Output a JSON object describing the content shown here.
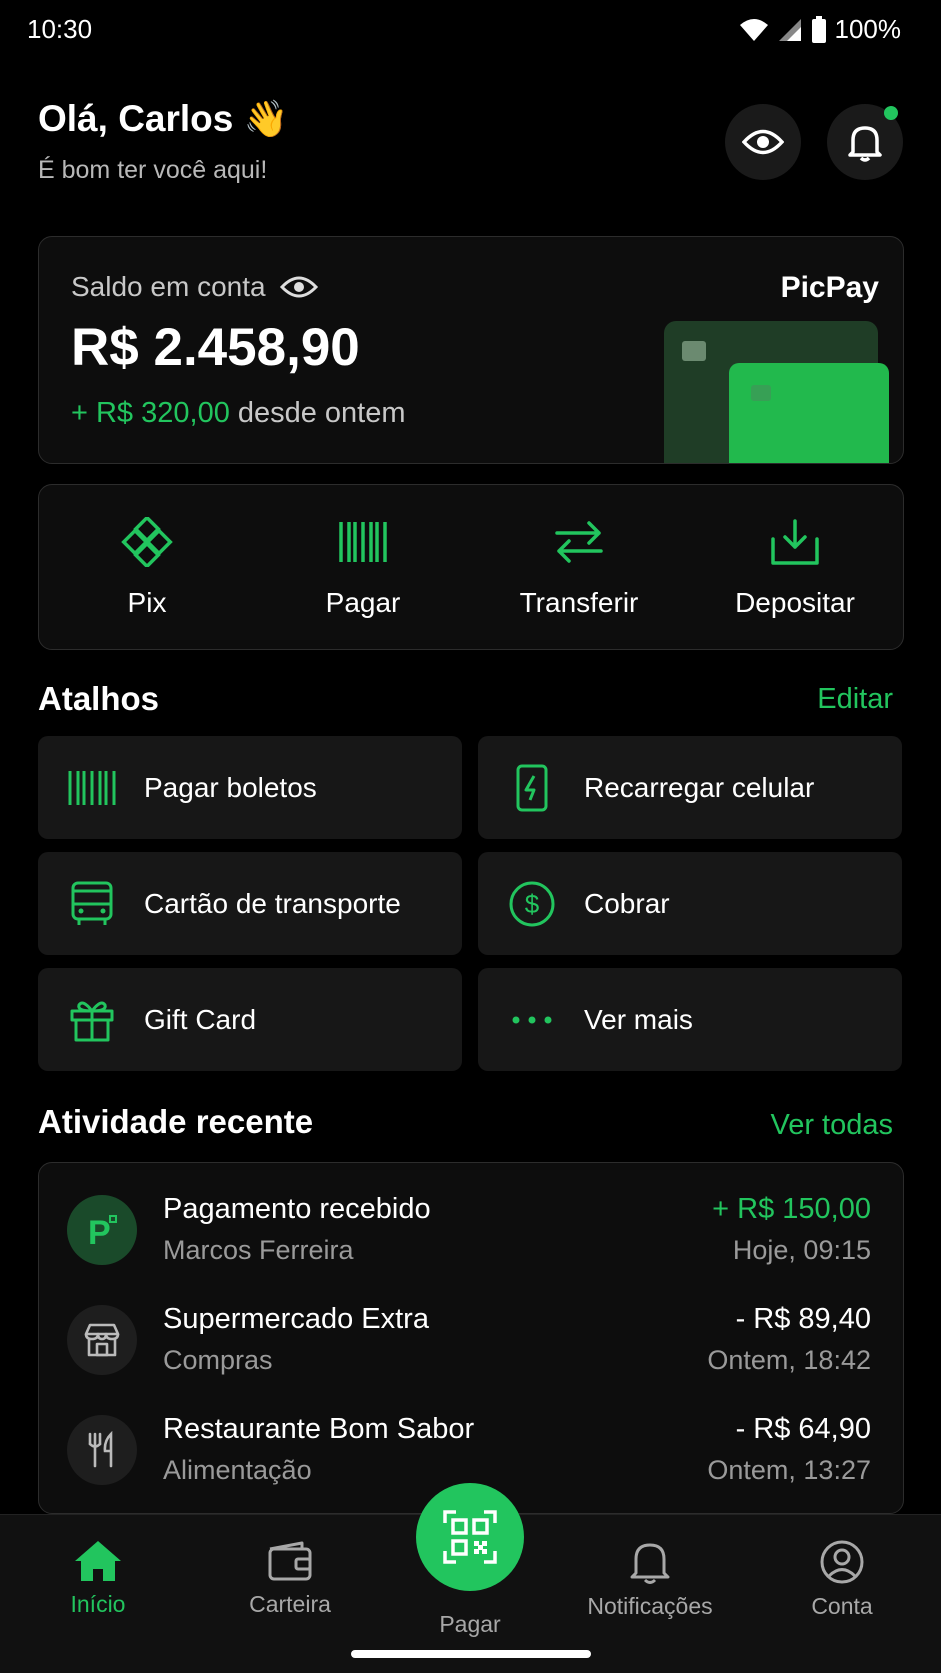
{
  "status_bar": {
    "time": "10:30",
    "battery": "100%"
  },
  "header": {
    "greeting": "Olá, Carlos",
    "emoji": "👋",
    "subtitle": "É bom ter você aqui!"
  },
  "balance": {
    "label": "Saldo em conta",
    "value": "R$ 2.458,90",
    "delta": "+ R$ 320,00",
    "delta_suffix": "desde ontem",
    "brand": "PicPay"
  },
  "quick_actions": [
    {
      "label": "Pix",
      "icon": "pix-icon"
    },
    {
      "label": "Pagar",
      "icon": "barcode-icon"
    },
    {
      "label": "Transferir",
      "icon": "transfer-icon"
    },
    {
      "label": "Depositar",
      "icon": "deposit-icon"
    }
  ],
  "shortcuts": {
    "title": "Atalhos",
    "edit_label": "Editar",
    "items": [
      {
        "label": "Pagar boletos",
        "icon": "barcode-icon"
      },
      {
        "label": "Recarregar celular",
        "icon": "phone-charge-icon"
      },
      {
        "label": "Cartão de transporte",
        "icon": "bus-icon"
      },
      {
        "label": "Cobrar",
        "icon": "dollar-circle-icon"
      },
      {
        "label": "Gift Card",
        "icon": "gift-icon"
      },
      {
        "label": "Ver mais",
        "icon": "more-dots-icon"
      }
    ]
  },
  "activity": {
    "title": "Atividade recente",
    "see_all": "Ver todas",
    "items": [
      {
        "name": "Pagamento recebido",
        "sub": "Marcos Ferreira",
        "amount": "+ R$ 150,00",
        "time": "Hoje, 09:15",
        "icon": "picpay-logo-icon",
        "positive": true
      },
      {
        "name": "Supermercado Extra",
        "sub": "Compras",
        "amount": "- R$ 89,40",
        "time": "Ontem, 18:42",
        "icon": "store-icon",
        "positive": false
      },
      {
        "name": "Restaurante Bom Sabor",
        "sub": "Alimentação",
        "amount": "- R$ 64,90",
        "time": "Ontem, 13:27",
        "icon": "cutlery-icon",
        "positive": false
      }
    ]
  },
  "bottom_nav": {
    "items": [
      {
        "label": "Início",
        "icon": "home-icon",
        "active": true
      },
      {
        "label": "Carteira",
        "icon": "wallet-icon",
        "active": false
      },
      {
        "label": "Pagar",
        "icon": "qr-code-icon",
        "active": false
      },
      {
        "label": "Notificações",
        "icon": "bell-icon",
        "active": false
      },
      {
        "label": "Conta",
        "icon": "user-icon",
        "active": false
      }
    ]
  },
  "colors": {
    "accent": "#22c55e",
    "background": "#000000",
    "surface": "#171717"
  }
}
